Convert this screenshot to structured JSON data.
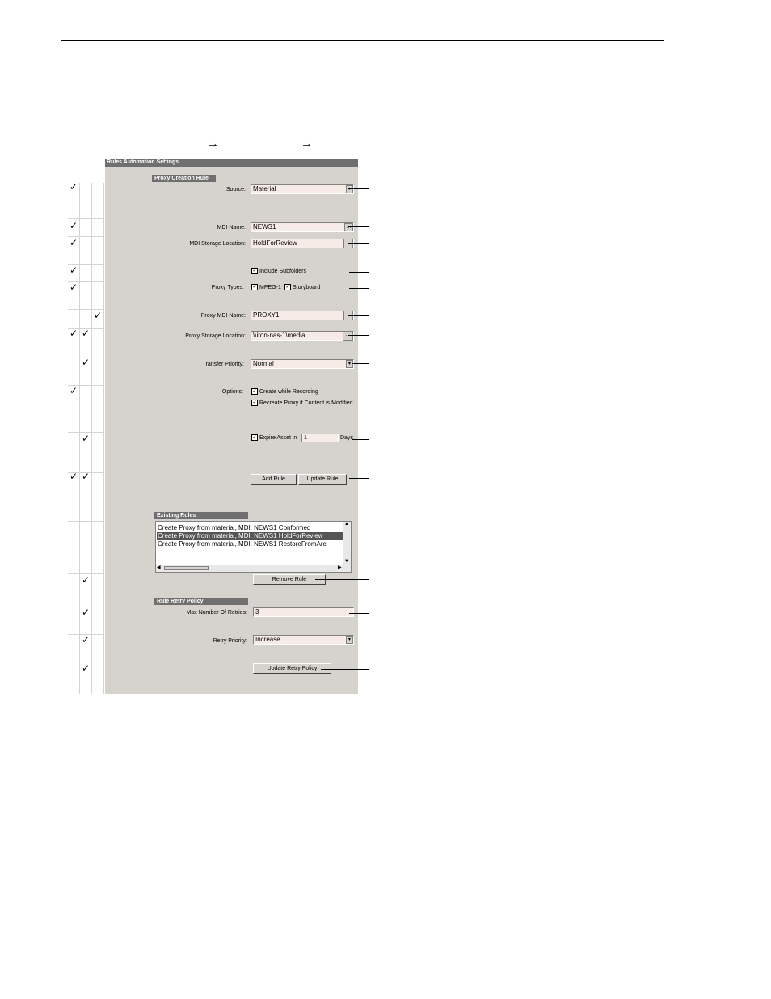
{
  "window": {
    "title": "Rules Automation Settings"
  },
  "arrows": [
    "→",
    "→"
  ],
  "proxy_rule": {
    "section": "Proxy Creation Rule",
    "source_label": "Source:",
    "source_value": "Material",
    "mdi_name_label": "MDI Name:",
    "mdi_name_value": "NEWS1",
    "mdi_storage_label": "MDI Storage Location:",
    "mdi_storage_value": "HoldForReview",
    "include_subfolders": "Include Subfolders",
    "proxy_types_label": "Proxy Types:",
    "mpeg1": "MPEG-1",
    "storyboard": "Storyboard",
    "proxy_mdi_label": "Proxy MDI Name:",
    "proxy_mdi_value": "PROXY1",
    "proxy_storage_label": "Proxy Storage Location:",
    "proxy_storage_value": "\\\\iron-nas-1\\media",
    "transfer_priority_label": "Transfer Priority:",
    "transfer_priority_value": "Normal",
    "options_label": "Options:",
    "create_while_recording": "Create while Recording",
    "recreate_proxy": "Recreate Proxy if Content is Modified",
    "expire_asset": "Expire Asset in",
    "expire_days_value": "1",
    "days": "Days",
    "add_rule": "Add Rule",
    "update_rule": "Update Rule"
  },
  "existing_rules": {
    "section": "Existing Rules",
    "rows": [
      "Create Proxy from material, MDI: NEWS1 Conformed",
      "Create Proxy from material, MDI: NEWS1 HoldForReview",
      "Create Proxy from material, MDI: NEWS1 RestoreFromArc"
    ],
    "remove_rule": "Remove Rule"
  },
  "retry_policy": {
    "section": "Rule Retry Policy",
    "max_retries_label": "Max Number Of Retries:",
    "max_retries_value": "3",
    "retry_priority_label": "Retry Priority:",
    "retry_priority_value": "Increase",
    "update_retry_policy": "Update Retry Policy"
  },
  "check_mark": "✓",
  "checkbox_mark": "✓",
  "dropdown_glyph": "▾",
  "browse_glyph": "…",
  "scroll": {
    "up": "▲",
    "down": "▼",
    "left": "◀",
    "right": "▶"
  }
}
